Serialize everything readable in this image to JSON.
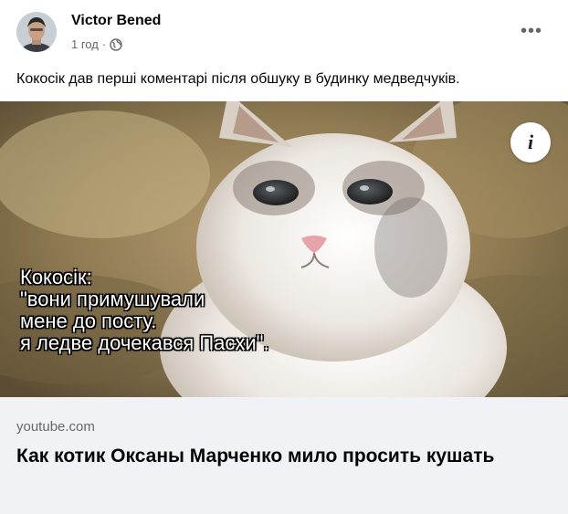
{
  "post": {
    "author": "Victor Bened",
    "time": "1 год",
    "separator": "·",
    "text": "Кокосік дав перші коментарі після обшуку в будинку медведчуків."
  },
  "media": {
    "caption_lines": [
      "Кокосік:",
      "\"вони примушували",
      "мене до посту.",
      "я ледве дочекався Пасхи\"."
    ]
  },
  "link": {
    "domain": "youtube.com",
    "title": "Как котик Оксаны Марченко мило просить кушать"
  },
  "icons": {
    "more": "more-options-icon",
    "info": "info-icon",
    "privacy": "globe-icon"
  }
}
